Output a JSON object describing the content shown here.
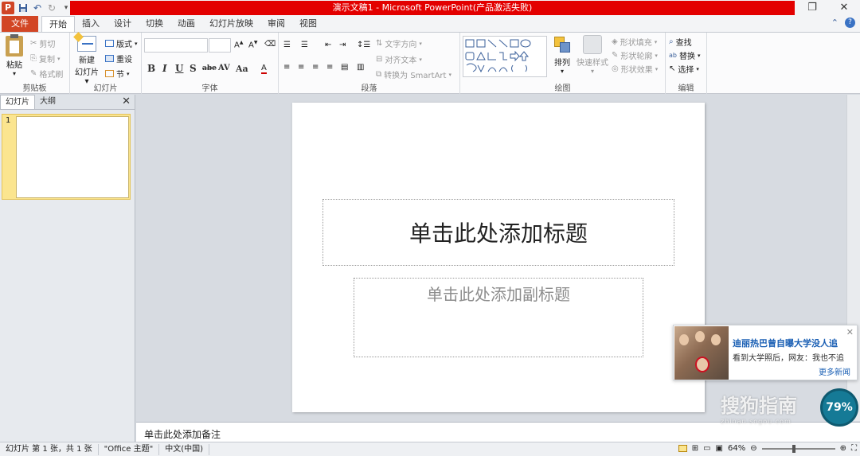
{
  "app": {
    "window_title": "演示文稿1 - Microsoft PowerPoint(产品激活失败)",
    "logo_letter": "P"
  },
  "window_controls": {
    "restore": "❐",
    "close": "✕"
  },
  "tabs": [
    {
      "label": "文件",
      "kind": "file"
    },
    {
      "label": "开始",
      "kind": "active"
    },
    {
      "label": "插入"
    },
    {
      "label": "设计"
    },
    {
      "label": "切换"
    },
    {
      "label": "动画"
    },
    {
      "label": "幻灯片放映"
    },
    {
      "label": "审阅"
    },
    {
      "label": "视图"
    }
  ],
  "ribbon": {
    "clipboard": {
      "paste": "粘贴",
      "cut": "剪切",
      "copy": "复制",
      "format_painter": "格式刷",
      "label": "剪贴板"
    },
    "slides": {
      "new_slide_1": "新建",
      "new_slide_2": "幻灯片",
      "layout": "版式",
      "reset": "重设",
      "section": "节",
      "label": "幻灯片"
    },
    "font": {
      "label": "字体",
      "bold": "B",
      "italic": "I",
      "underline": "U",
      "shadow": "S",
      "strike": "abe",
      "spacing": "AV",
      "case": "Aa"
    },
    "paragraph": {
      "text_direction": "文字方向",
      "align_text": "对齐文本",
      "smartart": "转换为 SmartArt",
      "label": "段落"
    },
    "drawing": {
      "arrange": "排列",
      "quick_styles": "快速样式",
      "shape_fill": "形状填充",
      "shape_outline": "形状轮廓",
      "shape_effects": "形状效果",
      "label": "绘图"
    },
    "editing": {
      "find": "查找",
      "replace": "替换",
      "select": "选择",
      "label": "编辑"
    }
  },
  "left_panel": {
    "tab_slides": "幻灯片",
    "tab_outline": "大纲",
    "close": "✕",
    "slide_number": "1"
  },
  "slide": {
    "title_placeholder": "单击此处添加标题",
    "subtitle_placeholder": "单击此处添加副标题"
  },
  "notes": {
    "placeholder": "单击此处添加备注"
  },
  "status": {
    "slide_info": "幻灯片 第 1 张，共 1 张",
    "theme": "\"Office 主题\"",
    "language": "中文(中国)",
    "zoom": "64%",
    "zoom_fraction": 0.64
  },
  "popup": {
    "headline": "迪丽热巴曾自曝大学没人追",
    "subtext": "看到大学照后，网友：我也不追",
    "more_link": "更多新闻",
    "close": "✕"
  },
  "overlay": {
    "watermark": "搜狗指南",
    "watermark_sub": "zhinan.sogou.com",
    "badge": "79%"
  },
  "colors": {
    "file_tab": "#d24625",
    "title_bar": "#e30000",
    "accent_link": "#1a5fb4"
  }
}
